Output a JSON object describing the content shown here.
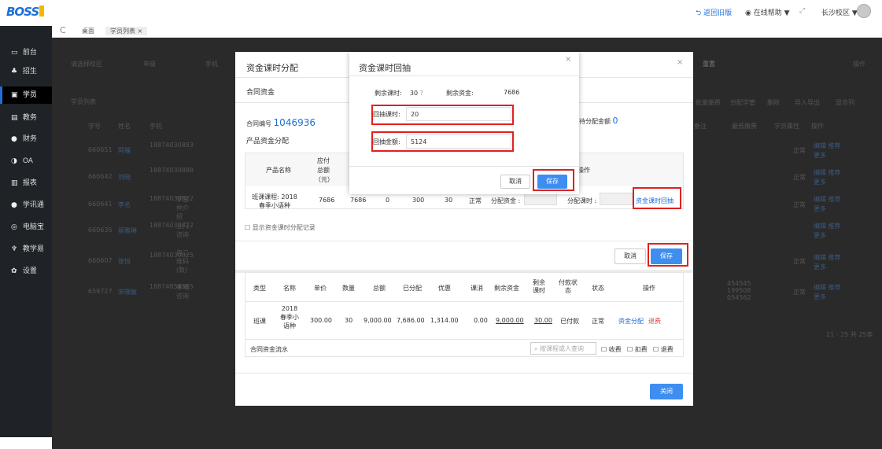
{
  "header": {
    "logo": "BOSS",
    "return_old": "返回旧版",
    "help": "在线帮助",
    "help_caret": "▼",
    "expand": "⤢",
    "campus": "长沙校区",
    "campus_caret": "▼"
  },
  "tabs": {
    "refresh": "C",
    "desk": "桌面",
    "students": "学员列表",
    "close": "×"
  },
  "sidebar": {
    "items": [
      {
        "icon": "▭",
        "label": "前台"
      },
      {
        "icon": "♣",
        "label": "招生"
      },
      {
        "icon": "▣",
        "label": "学员"
      },
      {
        "icon": "▤",
        "label": "教务"
      },
      {
        "icon": "●",
        "label": "财务"
      },
      {
        "icon": "◑",
        "label": "OA"
      },
      {
        "icon": "▥",
        "label": "报表"
      },
      {
        "icon": "●",
        "label": "学讯通"
      },
      {
        "icon": "◎",
        "label": "电脑宝"
      },
      {
        "icon": "♆",
        "label": "教学易"
      },
      {
        "icon": "✿",
        "label": "设置"
      }
    ]
  },
  "background": {
    "filter_campus": "请选择校区",
    "filter_grade": "年级",
    "filter_phone": "手机",
    "reset": "重置",
    "op": "操作",
    "list_title": "学员列表",
    "col_no": "学号",
    "col_name": "姓名",
    "col_phone": "手机",
    "col_type": "来源类型",
    "col_remark": "备注",
    "col_pay": "最低缴费",
    "col_attr": "学员属性",
    "col_op": "操作",
    "toolbar_btns": [
      "批量缴费",
      "分配学管",
      "删除",
      "导入导出",
      "显示列"
    ],
    "rows": [
      {
        "no": "660651",
        "name": "阿福",
        "phone": "18874030883",
        "type": "",
        "status": "正常",
        "op1": "编辑 推荐",
        "op2": "更多"
      },
      {
        "no": "660642",
        "name": "刘晓",
        "phone": "18874030888",
        "type": "",
        "status": "正常",
        "op1": "编辑 推荐",
        "op2": "更多"
      },
      {
        "no": "660641",
        "name": "李名",
        "phone": "18874030822",
        "type": "学生仲介绍",
        "status": "正常",
        "op1": "编辑 推荐",
        "op2": "更多"
      },
      {
        "no": "660635",
        "name": "蔡雅琳",
        "phone": "18874030822",
        "type": "上门咨询",
        "status": "",
        "op1": "编辑 推荐",
        "op2": "更多"
      },
      {
        "no": "660607",
        "name": "张悦",
        "phone": "18874030825",
        "type": "自二维码(数)",
        "status": "正常",
        "op1": "编辑 推荐",
        "op2": "更多"
      },
      {
        "no": "659727",
        "name": "宋晓敏",
        "phone": "18874858585",
        "type": "来电咨询",
        "status": "正常",
        "op1": "编辑 推荐",
        "op2": "更多",
        "remark": "454545 199508 054562"
      }
    ],
    "pagination": "21 - 25 共 25条"
  },
  "modal1": {
    "title": "资金课时分配",
    "close": "×",
    "section_contract": "合同资金",
    "contract_no_label": "合同编号",
    "contract_no": "1046936",
    "pending_label": "待分配金额",
    "pending_value": "0",
    "section_product": "产品资金分配",
    "col_product": "产品名称",
    "col_total": "应付总额（元）",
    "col_op": "操作",
    "product_name": "班课课程: 2018春季小语种",
    "product_total": "7686",
    "product_c2": "7686",
    "product_c3": "0",
    "product_c4": "300",
    "product_c5": "30",
    "product_status": "正常",
    "alloc_fund_label": "分配资金 :",
    "alloc_hours_label": "分配课时 :",
    "fund_hours_back": "资金课时回抽",
    "show_records": "显示资金课时分配记录",
    "cancel": "取消",
    "save": "保存",
    "contract_table": {
      "headers": [
        "类型",
        "名称",
        "单价",
        "数量",
        "总额",
        "已分配",
        "优惠",
        "课消",
        "剩余资金",
        "剩余课时",
        "付款状态",
        "状态",
        "操作"
      ],
      "row": {
        "type": "班课",
        "name": "2018春季小语种",
        "price": "300.00",
        "qty": "30",
        "total": "9,000.00",
        "allocated": "7,686.00",
        "discount": "1,314.00",
        "consumed": "0.00",
        "remaining_fund": "9,000.00",
        "remaining_hours": "30.00",
        "pay_status": "已付款",
        "status": "正常",
        "op_allocate": "资金分配",
        "op_refund": "退费"
      }
    },
    "flow_title": "合同资金流水",
    "flow_search_placeholder": "按课程或人查询",
    "flow_filters": [
      "收费",
      "扣费",
      "退费"
    ],
    "close_btn": "关闭"
  },
  "modal2": {
    "title": "资金课时回抽",
    "close": "×",
    "remaining_hours_label": "剩余课时:",
    "remaining_hours": "30",
    "remaining_fund_label": "剩余资金:",
    "remaining_fund": "7686",
    "back_hours_label": "回抽课时:",
    "back_hours_value": "20",
    "back_amount_label": "回抽金额:",
    "back_amount_value": "5124",
    "cancel": "取消",
    "save": "保存"
  },
  "colors": {
    "accent": "#3d8ef0",
    "highlight": "#e02020",
    "sidebar": "#1f2227"
  }
}
